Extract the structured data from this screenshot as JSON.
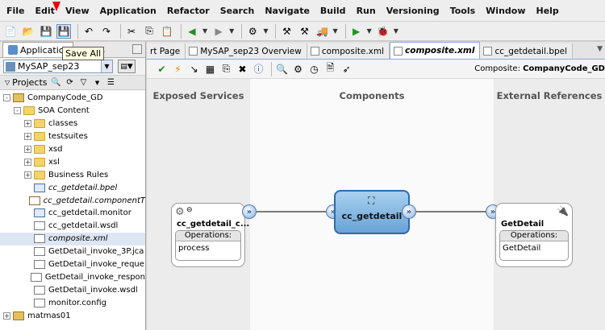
{
  "menu": [
    "File",
    "Edit",
    "View",
    "Application",
    "Refactor",
    "Search",
    "Navigate",
    "Build",
    "Run",
    "Versioning",
    "Tools",
    "Window",
    "Help"
  ],
  "left_panel": {
    "tab_label": "Application",
    "tab_dots": "...",
    "tooltip": "Save All",
    "app_name": "MySAP_sep23",
    "projects_label": "Projects"
  },
  "tree": [
    {
      "label": "CompanyCode_GD",
      "indent": 0,
      "expand": "-",
      "icon": "proj",
      "italic": false
    },
    {
      "label": "SOA Content",
      "indent": 1,
      "expand": "-",
      "icon": "folder",
      "italic": false
    },
    {
      "label": "classes",
      "indent": 2,
      "expand": "+",
      "icon": "folder",
      "italic": false
    },
    {
      "label": "testsuites",
      "indent": 2,
      "expand": "+",
      "icon": "folder",
      "italic": false
    },
    {
      "label": "xsd",
      "indent": 2,
      "expand": "+",
      "icon": "folder",
      "italic": false
    },
    {
      "label": "xsl",
      "indent": 2,
      "expand": "+",
      "icon": "folder",
      "italic": false
    },
    {
      "label": "Business Rules",
      "indent": 2,
      "expand": "+",
      "icon": "folder",
      "italic": false
    },
    {
      "label": "cc_getdetail.bpel",
      "indent": 2,
      "expand": "",
      "icon": "file-blue",
      "italic": true
    },
    {
      "label": "cc_getdetail.componentT",
      "indent": 2,
      "expand": "",
      "icon": "file-gear",
      "italic": true
    },
    {
      "label": "cc_getdetail.monitor",
      "indent": 2,
      "expand": "",
      "icon": "file-blue",
      "italic": false
    },
    {
      "label": "cc_getdetail.wsdl",
      "indent": 2,
      "expand": "",
      "icon": "file",
      "italic": false
    },
    {
      "label": "composite.xml",
      "indent": 2,
      "expand": "",
      "icon": "file",
      "italic": true,
      "selected": true
    },
    {
      "label": "GetDetail_invoke_3P.jca",
      "indent": 2,
      "expand": "",
      "icon": "file",
      "italic": false
    },
    {
      "label": "GetDetail_invoke_reque",
      "indent": 2,
      "expand": "",
      "icon": "file",
      "italic": false
    },
    {
      "label": "GetDetail_invoke_respon",
      "indent": 2,
      "expand": "",
      "icon": "file",
      "italic": false
    },
    {
      "label": "GetDetail_invoke.wsdl",
      "indent": 2,
      "expand": "",
      "icon": "file",
      "italic": false
    },
    {
      "label": "monitor.config",
      "indent": 2,
      "expand": "",
      "icon": "file",
      "italic": false
    },
    {
      "label": "matmas01",
      "indent": 0,
      "expand": "+",
      "icon": "proj",
      "italic": false
    }
  ],
  "editor_tabs": [
    {
      "label": "rt Page",
      "active": false
    },
    {
      "label": "MySAP_sep23 Overview",
      "active": false
    },
    {
      "label": "composite.xml",
      "active": false
    },
    {
      "label": "composite.xml",
      "active": true
    },
    {
      "label": "cc_getdetail.bpel",
      "active": false
    }
  ],
  "composite": {
    "label": "Composite:",
    "name": "CompanyCode_GD"
  },
  "canvas": {
    "col_exposed": "Exposed Services",
    "col_components": "Components",
    "col_external": "External References",
    "exposed_service": {
      "title": "cc_getdetail_c...",
      "ops_label": "Operations:",
      "operation": "process"
    },
    "component": {
      "label": "cc_getdetail"
    },
    "reference": {
      "title": "GetDetail",
      "ops_label": "Operations:",
      "operation": "GetDetail"
    }
  }
}
